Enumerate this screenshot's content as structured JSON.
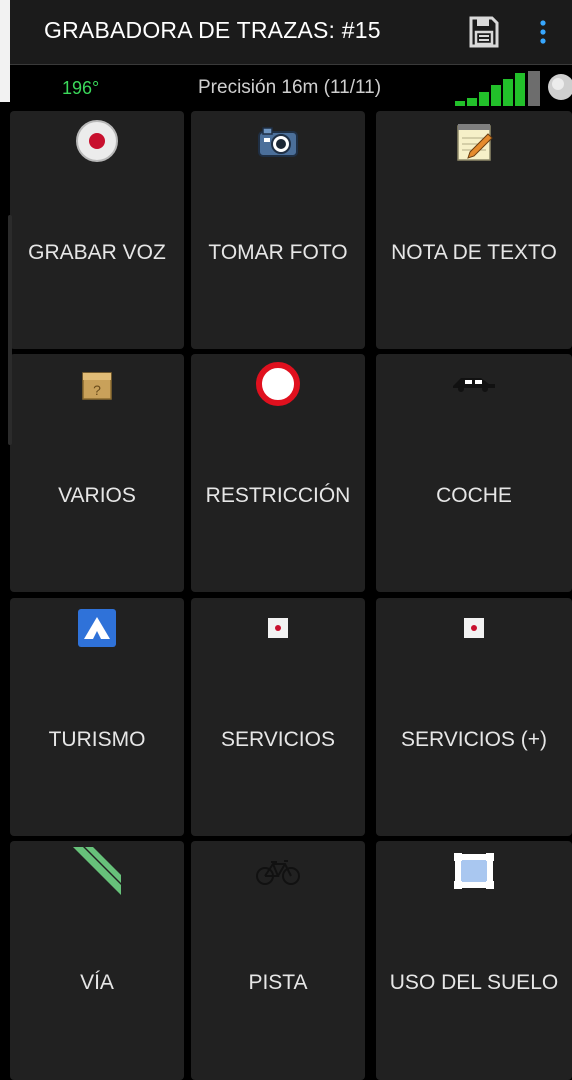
{
  "appbar": {
    "title": "GRABADORA DE TRAZAS: #15",
    "save_icon": "floppy-disk-icon",
    "menu_icon": "more-vertical-icon"
  },
  "status": {
    "heading": "196°",
    "precision": "Precisión 16m (11/11)",
    "signal_icon": "signal-bars-icon",
    "gps_icon": "gps-status-icon",
    "colors": {
      "heading": "#3bd85a",
      "signal_bars": "#22c02a"
    }
  },
  "tiles": [
    {
      "label": "GRABAR VOZ",
      "icon": "record-icon"
    },
    {
      "label": "TOMAR FOTO",
      "icon": "camera-icon"
    },
    {
      "label": "NOTA DE TEXTO",
      "icon": "notepad-icon"
    },
    {
      "label": "VARIOS",
      "icon": "mystery-box-icon"
    },
    {
      "label": "RESTRICCIÓN",
      "icon": "no-entry-sign-icon"
    },
    {
      "label": "COCHE",
      "icon": "car-icon"
    },
    {
      "label": "TURISMO",
      "icon": "campsite-icon"
    },
    {
      "label": "SERVICIOS",
      "icon": "small-poi-icon"
    },
    {
      "label": "SERVICIOS (+)",
      "icon": "small-poi-icon"
    },
    {
      "label": "VÍA",
      "icon": "road-icon"
    },
    {
      "label": "PISTA",
      "icon": "bicycle-icon"
    },
    {
      "label": "USO DEL SUELO",
      "icon": "area-frame-icon"
    }
  ]
}
